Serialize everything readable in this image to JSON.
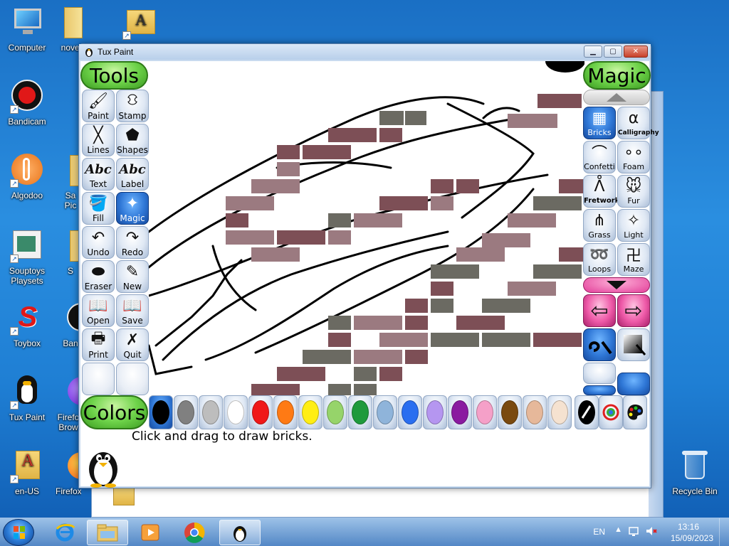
{
  "desktop": {
    "icons": [
      {
        "label": "Computer"
      },
      {
        "label": "novel"
      },
      {
        "label": ""
      },
      {
        "label": "Bandicam"
      },
      {
        "label": "Algodoo"
      },
      {
        "label": "Sa Pic"
      },
      {
        "label": "Souptoys Playsets"
      },
      {
        "label": "S"
      },
      {
        "label": "Toybox"
      },
      {
        "label": "Ban"
      },
      {
        "label": "Tux Paint"
      },
      {
        "label": "Firefo Brow"
      },
      {
        "label": "en-US"
      },
      {
        "label": "Firefox"
      },
      {
        "label": "Recycle Bin"
      }
    ]
  },
  "window": {
    "title": "Tux Paint",
    "min_label": "▁",
    "max_label": "▢",
    "close_label": "✕"
  },
  "tools": {
    "header": "Tools",
    "items": [
      {
        "label": "Paint",
        "glyph": "🖌"
      },
      {
        "label": "Stamp",
        "glyph": "⛻"
      },
      {
        "label": "Lines",
        "glyph": "╳"
      },
      {
        "label": "Shapes",
        "glyph": "⬟"
      },
      {
        "label": "Text",
        "glyph": "Abc"
      },
      {
        "label": "Label",
        "glyph": "Abc"
      },
      {
        "label": "Fill",
        "glyph": "🪣"
      },
      {
        "label": "Magic",
        "glyph": "✦"
      },
      {
        "label": "Undo",
        "glyph": "↶"
      },
      {
        "label": "Redo",
        "glyph": "↷"
      },
      {
        "label": "Eraser",
        "glyph": "⬬"
      },
      {
        "label": "New",
        "glyph": "✎"
      },
      {
        "label": "Open",
        "glyph": "📖"
      },
      {
        "label": "Save",
        "glyph": "📖"
      },
      {
        "label": "Print",
        "glyph": "🖶"
      },
      {
        "label": "Quit",
        "glyph": "✗"
      }
    ]
  },
  "magic": {
    "header": "Magic",
    "items": [
      {
        "label": "Bricks",
        "glyph": "▦"
      },
      {
        "label": "Calligraphy",
        "glyph": "α"
      },
      {
        "label": "Confetti",
        "glyph": "⌒"
      },
      {
        "label": "Foam",
        "glyph": "∘∘"
      },
      {
        "label": "Fretwork",
        "glyph": "ᐰ"
      },
      {
        "label": "Fur",
        "glyph": "🐭"
      },
      {
        "label": "Grass",
        "glyph": "⋔"
      },
      {
        "label": "Light",
        "glyph": "✧"
      },
      {
        "label": "Loops",
        "glyph": "➿"
      },
      {
        "label": "Maze",
        "glyph": "卍"
      }
    ],
    "prev_glyph": "⇦",
    "next_glyph": "⇨"
  },
  "colors": {
    "header": "Colors",
    "swatches": [
      {
        "name": "black",
        "hex": "#000000"
      },
      {
        "name": "dark-gray",
        "hex": "#808080"
      },
      {
        "name": "light-gray",
        "hex": "#bdbdbd"
      },
      {
        "name": "white",
        "hex": "#ffffff"
      },
      {
        "name": "red",
        "hex": "#f01818"
      },
      {
        "name": "orange",
        "hex": "#ff7a14"
      },
      {
        "name": "yellow",
        "hex": "#ffee14"
      },
      {
        "name": "light-green",
        "hex": "#96d46a"
      },
      {
        "name": "green",
        "hex": "#1e9a3c"
      },
      {
        "name": "sky-blue",
        "hex": "#8fb4da"
      },
      {
        "name": "blue",
        "hex": "#2a6ef0"
      },
      {
        "name": "lavender",
        "hex": "#b596f0"
      },
      {
        "name": "purple",
        "hex": "#8a1aa0"
      },
      {
        "name": "pink",
        "hex": "#f5a0c8"
      },
      {
        "name": "brown",
        "hex": "#7a4a10"
      },
      {
        "name": "tan",
        "hex": "#e6b89a"
      },
      {
        "name": "beige",
        "hex": "#f5e2d0"
      }
    ],
    "selected": "black"
  },
  "status": {
    "message": "Click and drag to draw bricks."
  },
  "taskbar": {
    "language": "EN",
    "time": "13:16",
    "date": "15/09/2023"
  }
}
